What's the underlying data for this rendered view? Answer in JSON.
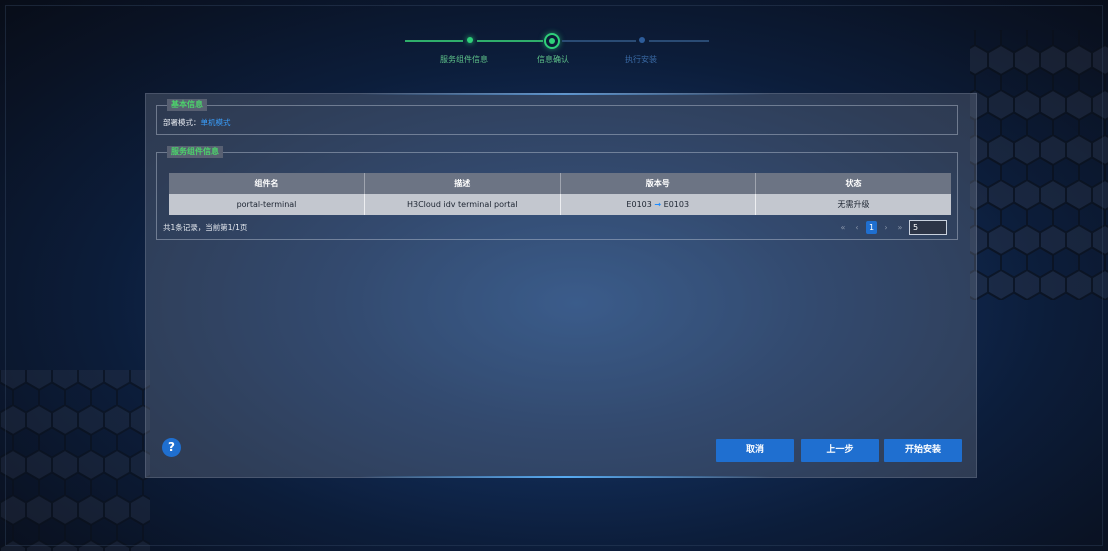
{
  "steps": [
    {
      "label": "服务组件信息",
      "state": "done"
    },
    {
      "label": "信息确认",
      "state": "current"
    },
    {
      "label": "执行安装",
      "state": "future"
    }
  ],
  "basic_info": {
    "legend": "基本信息",
    "mode_label": "部署模式：",
    "mode_value": "单机模式"
  },
  "components": {
    "legend": "服务组件信息",
    "columns": [
      "组件名",
      "描述",
      "版本号",
      "状态"
    ],
    "rows": [
      {
        "name": "portal-terminal",
        "description": "H3Cloud idv terminal portal",
        "version_from": "E0103",
        "version_arrow": "→",
        "version_to": "E0103",
        "status": "无需升级"
      }
    ],
    "summary": "共1条记录，当前第1/1页",
    "pager": {
      "first": "«",
      "prev": "‹",
      "current": "1",
      "next": "›",
      "last": "»",
      "page_size": "5"
    }
  },
  "buttons": {
    "help": "?",
    "cancel": "取消",
    "previous": "上一步",
    "start_install": "开始安装"
  },
  "colors": {
    "accent": "#1f6fd0",
    "success": "#2fd07a",
    "legend": "#4cd36b"
  }
}
